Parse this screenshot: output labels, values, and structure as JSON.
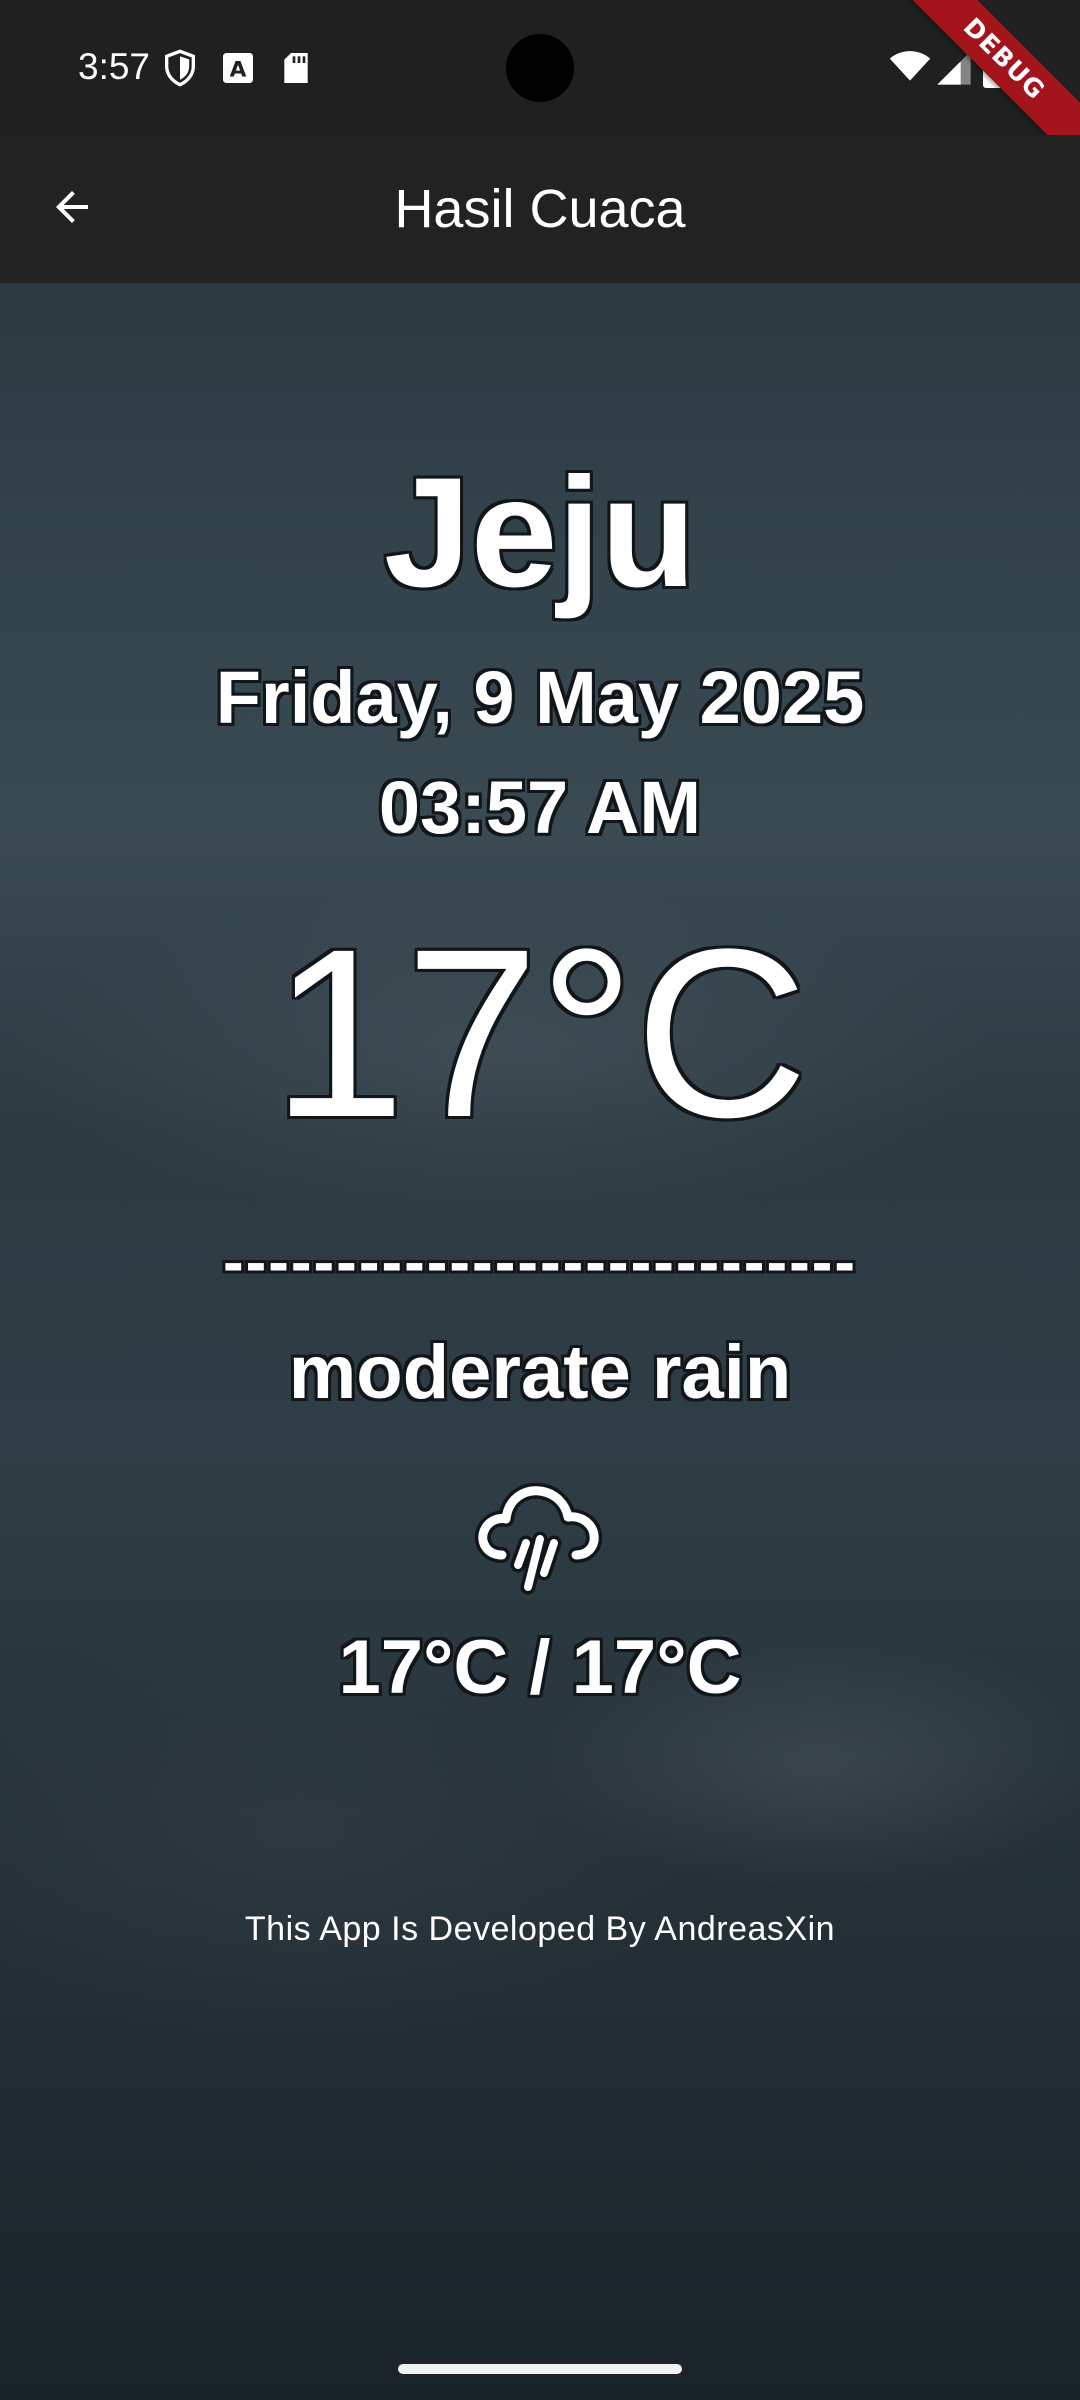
{
  "status_bar": {
    "time": "3:57",
    "icons": [
      "shield-icon",
      "font-a-icon",
      "sd-card-icon",
      "wifi-icon",
      "signal-icon",
      "battery-icon"
    ]
  },
  "debug_banner": {
    "label": "DEBUG",
    "color": "#a3141c"
  },
  "app_bar": {
    "back_icon": "arrow-back-icon",
    "title": "Hasil Cuaca"
  },
  "weather": {
    "city": "Jeju",
    "date": "Friday, 9 May 2025",
    "time": "03:57 AM",
    "temperature": "17°C",
    "divider": "----------------------------",
    "condition": "moderate rain",
    "condition_icon": "rain-cloud-icon",
    "temp_range": "17°C / 17°C"
  },
  "footer": {
    "credit": "This App Is Developed By AndreasXin"
  },
  "colors": {
    "text": "#ffffff",
    "app_bar_bg": "#222222",
    "text_outline": "#10161a"
  }
}
